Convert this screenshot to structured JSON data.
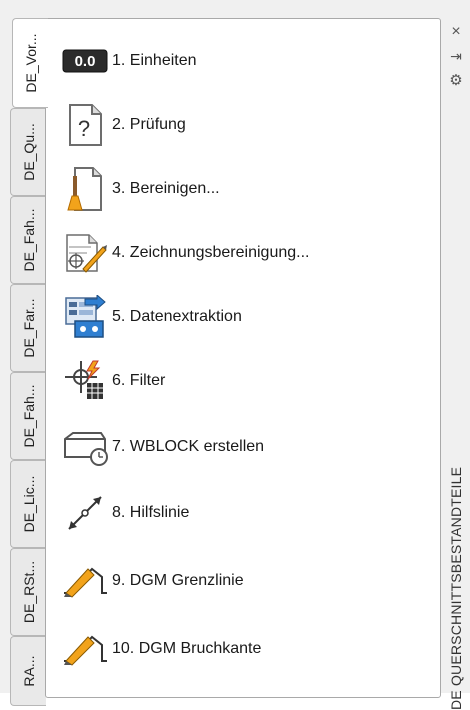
{
  "tabs": [
    {
      "label": "DE_Vor..."
    },
    {
      "label": "DE_Qu..."
    },
    {
      "label": "DE_Fah..."
    },
    {
      "label": "DE_Far..."
    },
    {
      "label": "DE_Fah..."
    },
    {
      "label": "DE_Lic..."
    },
    {
      "label": "DE_RSt..."
    },
    {
      "label": "RA..."
    }
  ],
  "items": [
    {
      "label": "1. Einheiten",
      "icon": "units-icon"
    },
    {
      "label": "2. Prüfung",
      "icon": "audit-document-icon"
    },
    {
      "label": "3. Bereinigen...",
      "icon": "purge-broom-icon"
    },
    {
      "label": "4. Zeichnungsbereinigung...",
      "icon": "drawing-cleanup-icon"
    },
    {
      "label": "5. Datenextraktion",
      "icon": "data-extraction-icon"
    },
    {
      "label": "6. Filter",
      "icon": "filter-icon"
    },
    {
      "label": "7. WBLOCK erstellen",
      "icon": "wblock-icon"
    },
    {
      "label": "8. Hilfslinie",
      "icon": "construction-line-icon"
    },
    {
      "label": "9. DGM Grenzlinie",
      "icon": "dtm-boundary-icon"
    },
    {
      "label": "10. DGM Bruchkante",
      "icon": "dtm-breakline-icon"
    }
  ],
  "units_icon_text": "0.0",
  "audit_icon_text": "?",
  "palette_title": "DE QUERSCHNITTSBESTANDTEILE",
  "strip": {
    "close": "×",
    "pin": "⇥",
    "settings": "⚙"
  }
}
